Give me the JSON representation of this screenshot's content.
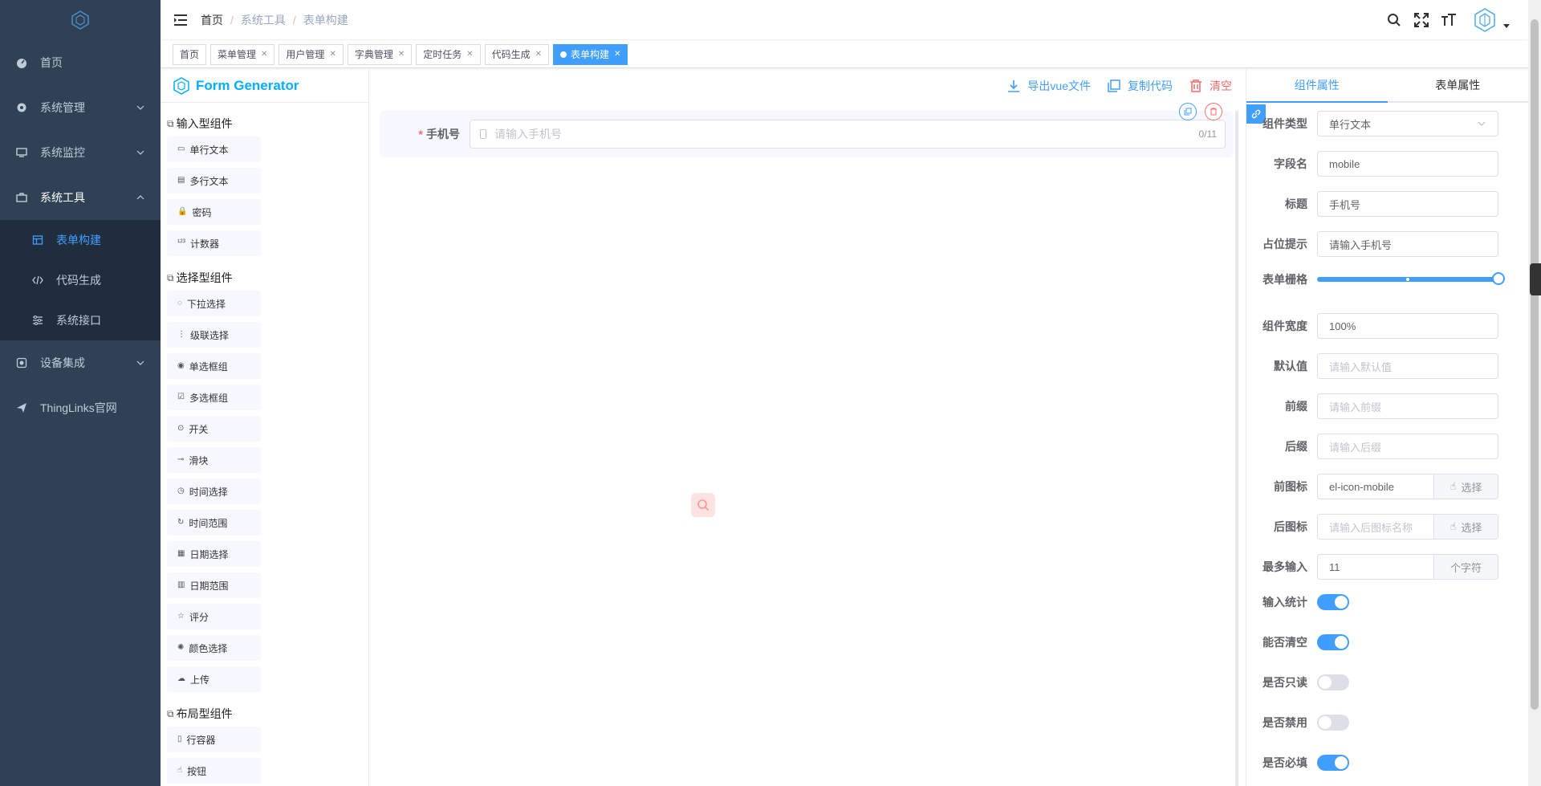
{
  "sidebar": {
    "items": [
      {
        "label": "首页",
        "icon": "dashboard-icon"
      },
      {
        "label": "系统管理",
        "icon": "system-icon"
      },
      {
        "label": "系统监控",
        "icon": "monitor-icon"
      },
      {
        "label": "系统工具",
        "icon": "tool-icon"
      },
      {
        "label": "设备集成",
        "icon": "device-icon"
      },
      {
        "label": "ThingLinks官网",
        "icon": "guide-icon"
      }
    ],
    "sub_items": [
      {
        "label": "表单构建",
        "icon": "build-icon"
      },
      {
        "label": "代码生成",
        "icon": "code-icon"
      },
      {
        "label": "系统接口",
        "icon": "swagger-icon"
      }
    ]
  },
  "breadcrumb": [
    "首页",
    "系统工具",
    "表单构建"
  ],
  "tags": [
    {
      "label": "首页"
    },
    {
      "label": "菜单管理"
    },
    {
      "label": "用户管理"
    },
    {
      "label": "字典管理"
    },
    {
      "label": "定时任务"
    },
    {
      "label": "代码生成"
    },
    {
      "label": "表单构建"
    }
  ],
  "generator": {
    "title": "Form Generator",
    "groups": [
      {
        "title": "输入型组件",
        "items": [
          "单行文本",
          "多行文本",
          "密码",
          "计数器"
        ]
      },
      {
        "title": "选择型组件",
        "items": [
          "下拉选择",
          "级联选择",
          "单选框组",
          "多选框组",
          "开关",
          "滑块",
          "时间选择",
          "时间范围",
          "日期选择",
          "日期范围",
          "评分",
          "颜色选择",
          "上传"
        ]
      },
      {
        "title": "布局型组件",
        "items": [
          "行容器",
          "按钮"
        ]
      }
    ]
  },
  "actions": {
    "export": "导出vue文件",
    "copy": "复制代码",
    "clear": "清空"
  },
  "canvas": {
    "field_label": "手机号",
    "placeholder": "请输入手机号",
    "counter": "0/11"
  },
  "right_panel": {
    "tabs": [
      "组件属性",
      "表单属性"
    ],
    "fields": {
      "type": {
        "label": "组件类型",
        "value": "单行文本"
      },
      "field_name": {
        "label": "字段名",
        "value": "mobile"
      },
      "title": {
        "label": "标题",
        "value": "手机号"
      },
      "placeholder": {
        "label": "占位提示",
        "value": "请输入手机号"
      },
      "grid": {
        "label": "表单栅格",
        "value": 24,
        "max": 24
      },
      "width": {
        "label": "组件宽度",
        "value": "100%"
      },
      "default": {
        "label": "默认值",
        "placeholder": "请输入默认值"
      },
      "prefix": {
        "label": "前缀",
        "placeholder": "请输入前缀"
      },
      "suffix": {
        "label": "后缀",
        "placeholder": "请输入后缀"
      },
      "prefix_icon": {
        "label": "前图标",
        "value": "el-icon-mobile",
        "button": "选择"
      },
      "suffix_icon": {
        "label": "后图标",
        "placeholder": "请输入后图标名称",
        "button": "选择"
      },
      "maxlength": {
        "label": "最多输入",
        "value": "11",
        "append": "个字符"
      },
      "show_word_limit": {
        "label": "输入统计",
        "on": true
      },
      "clearable": {
        "label": "能否清空",
        "on": true
      },
      "readonly": {
        "label": "是否只读",
        "on": false
      },
      "disabled": {
        "label": "是否禁用",
        "on": false
      },
      "required": {
        "label": "是否必填",
        "on": true
      }
    }
  },
  "colors": {
    "sidebar_bg": "#304156",
    "submenu_bg": "#1f2d3d",
    "primary": "#409eff",
    "danger": "#f56c6c",
    "title": "#00afff"
  }
}
